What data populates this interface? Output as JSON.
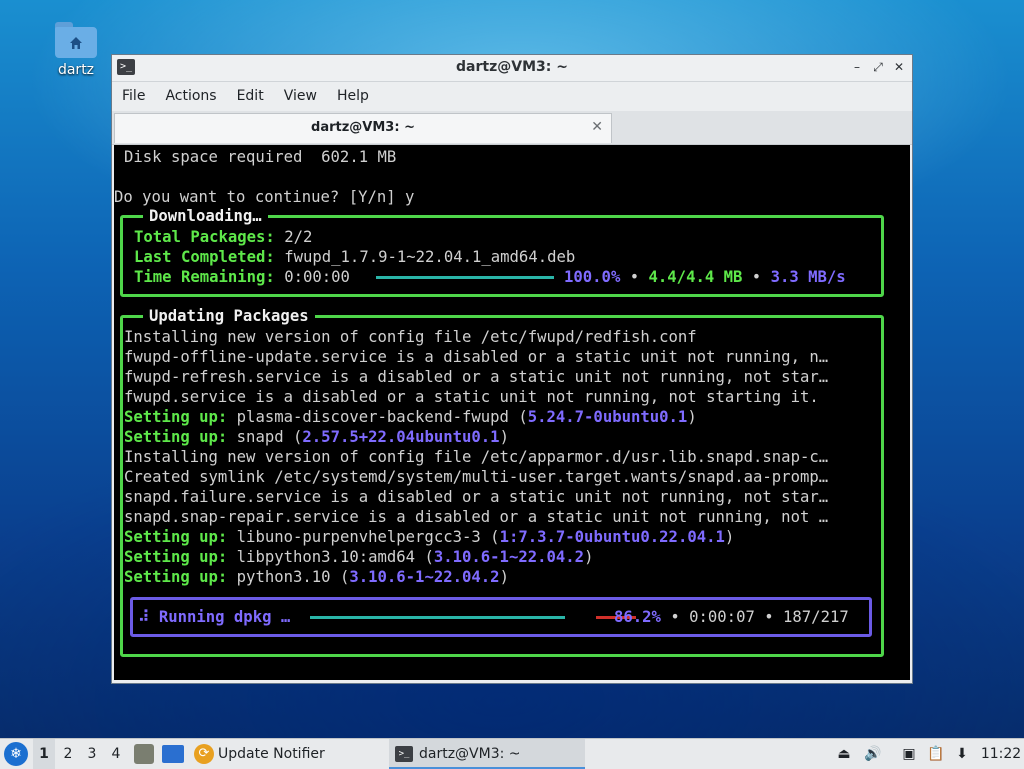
{
  "desktop": {
    "icon_label": "dartz"
  },
  "window": {
    "title": "dartz@VM3: ~",
    "menu": [
      "File",
      "Actions",
      "Edit",
      "View",
      "Help"
    ],
    "tab_label": "dartz@VM3: ~"
  },
  "terminal": {
    "disk_line": "Disk space required  602.1 MB",
    "prompt_line": "Do you want to continue? [Y/n] y",
    "download": {
      "title": "Downloading…",
      "total_label": "Total Packages:",
      "total_value": "2/2",
      "last_label": "Last Completed:",
      "last_value": "fwupd_1.7.9-1~22.04.1_amd64.deb",
      "time_label": "Time Remaining:",
      "time_value": "0:00:00",
      "percent": "100.0%",
      "size": "4.4/4.4 MB",
      "speed": "3.3 MB/s",
      "progress": 1.0
    },
    "update": {
      "title": "Updating Packages",
      "lines": [
        {
          "type": "plain",
          "text": "Installing new version of config file /etc/fwupd/redfish.conf"
        },
        {
          "type": "plain",
          "text": "fwupd-offline-update.service is a disabled or a static unit not running, n…"
        },
        {
          "type": "plain",
          "text": "fwupd-refresh.service is a disabled or a static unit not running, not star…"
        },
        {
          "type": "plain",
          "text": "fwupd.service is a disabled or a static unit not running, not starting it."
        },
        {
          "type": "setup",
          "label": "Setting up:",
          "pkg": "plasma-discover-backend-fwupd",
          "ver": "5.24.7-0ubuntu0.1"
        },
        {
          "type": "setup",
          "label": "Setting up:",
          "pkg": "snapd",
          "ver": "2.57.5+22.04ubuntu0.1"
        },
        {
          "type": "plain",
          "text": "Installing new version of config file /etc/apparmor.d/usr.lib.snapd.snap-c…"
        },
        {
          "type": "plain",
          "text": "Created symlink /etc/systemd/system/multi-user.target.wants/snapd.aa-promp…"
        },
        {
          "type": "plain",
          "text": "snapd.failure.service is a disabled or a static unit not running, not star…"
        },
        {
          "type": "plain",
          "text": "snapd.snap-repair.service is a disabled or a static unit not running, not …"
        },
        {
          "type": "setup",
          "label": "Setting up:",
          "pkg": "libuno-purpenvhelpergcc3-3",
          "ver": "1:7.3.7-0ubuntu0.22.04.1"
        },
        {
          "type": "setup",
          "label": "Setting up:",
          "pkg": "libpython3.10:amd64",
          "ver": "3.10.6-1~22.04.2"
        },
        {
          "type": "setup",
          "label": "Setting up:",
          "pkg": "python3.10",
          "ver": "3.10.6-1~22.04.2"
        }
      ],
      "running": {
        "spinner": "⠼",
        "label": "Running dpkg …",
        "percent": "86.2%",
        "elapsed": "0:00:07",
        "count": "187/217",
        "progress": 0.862
      }
    }
  },
  "taskbar": {
    "workspaces": [
      "1",
      "2",
      "3",
      "4"
    ],
    "active_workspace": "1",
    "tasks": [
      {
        "label": "Update Notifier",
        "icon": "update-notifier-icon"
      },
      {
        "label": "dartz@VM3: ~",
        "icon": "terminal-icon"
      }
    ],
    "clock": "11:22"
  },
  "colors": {
    "terminal_bg": "#000000",
    "box_green": "#4fd64a",
    "accent_purple": "#7f6bff",
    "bar_teal": "#2ab5a8"
  }
}
